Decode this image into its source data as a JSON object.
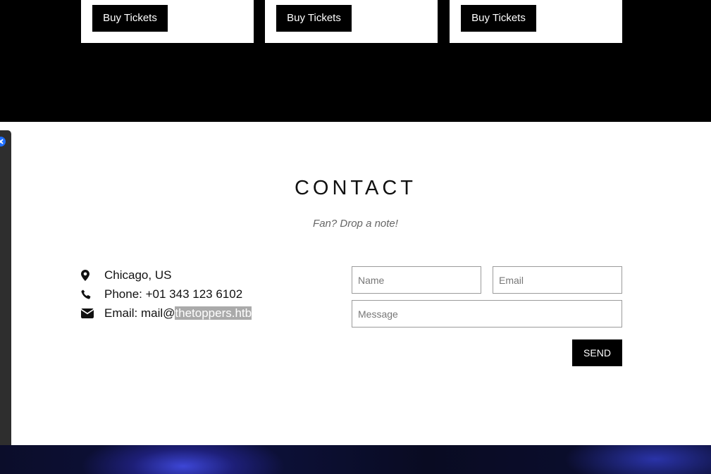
{
  "tickets": {
    "cards": [
      {
        "button_label": "Buy Tickets"
      },
      {
        "button_label": "Buy Tickets"
      },
      {
        "button_label": "Buy Tickets"
      }
    ]
  },
  "contact": {
    "title": "CONTACT",
    "subtitle": "Fan? Drop a note!",
    "info": {
      "location": "Chicago, US",
      "phone": "Phone: +01 343 123 6102",
      "email_prefix": "Email: mail@",
      "email_domain": "thetoppers.htb"
    },
    "form": {
      "name_placeholder": "Name",
      "email_placeholder": "Email",
      "message_placeholder": "Message",
      "send_label": "SEND"
    }
  },
  "icons": {
    "location": "map-marker-icon",
    "phone": "phone-icon",
    "email": "envelope-icon",
    "close": "close-icon"
  },
  "colors": {
    "dark": "#000000",
    "accent_close": "#1f6fff",
    "email_highlight": "#aaaaaa"
  }
}
